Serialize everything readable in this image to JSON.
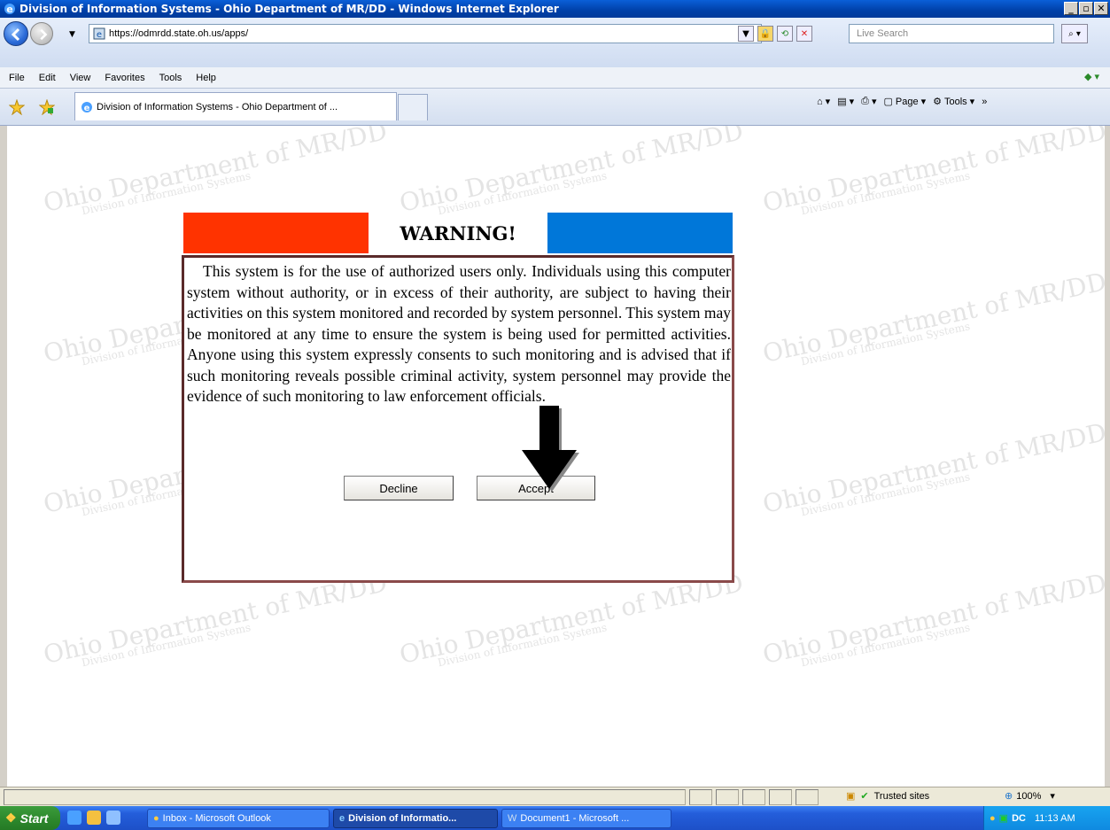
{
  "window": {
    "title": "Division of Information Systems - Ohio Department of MR/DD - Windows Internet Explorer"
  },
  "addressbar": {
    "url": "https://odmrdd.state.oh.us/apps/",
    "search_placeholder": "Live Search"
  },
  "menubar": {
    "items": [
      "File",
      "Edit",
      "View",
      "Favorites",
      "Tools",
      "Help"
    ]
  },
  "tabs": {
    "active_label": "Division of Information Systems - Ohio Department of ..."
  },
  "commandbar": {
    "page_label": "Page",
    "tools_label": "Tools"
  },
  "watermark": {
    "line1": "Ohio Department of MR/DD",
    "line2": "Division of Information Systems"
  },
  "warning": {
    "title": "WARNING!",
    "body": "This system is for the use of authorized users only. Individuals using this computer system without authority, or in excess of their authority, are subject to having their activities on this system monitored and recorded by system personnel. This system may be monitored at any time to ensure the system is being used for permitted activities. Anyone using this system expressly consents to such monitoring and is advised that if such monitoring reveals possible criminal activity, system personnel may provide the evidence of such monitoring to law enforcement officials.",
    "decline_label": "Decline",
    "accept_label": "Accept",
    "colors": {
      "left_bar": "#ff3300",
      "right_bar": "#0077d9"
    }
  },
  "statusbar": {
    "zone": "Trusted sites",
    "zoom": "100%"
  },
  "taskbar": {
    "start_label": "Start",
    "buttons": [
      "Inbox - Microsoft Outlook",
      "Division of Informatio...",
      "Document1 - Microsoft ..."
    ],
    "clock": "11:13 AM"
  }
}
